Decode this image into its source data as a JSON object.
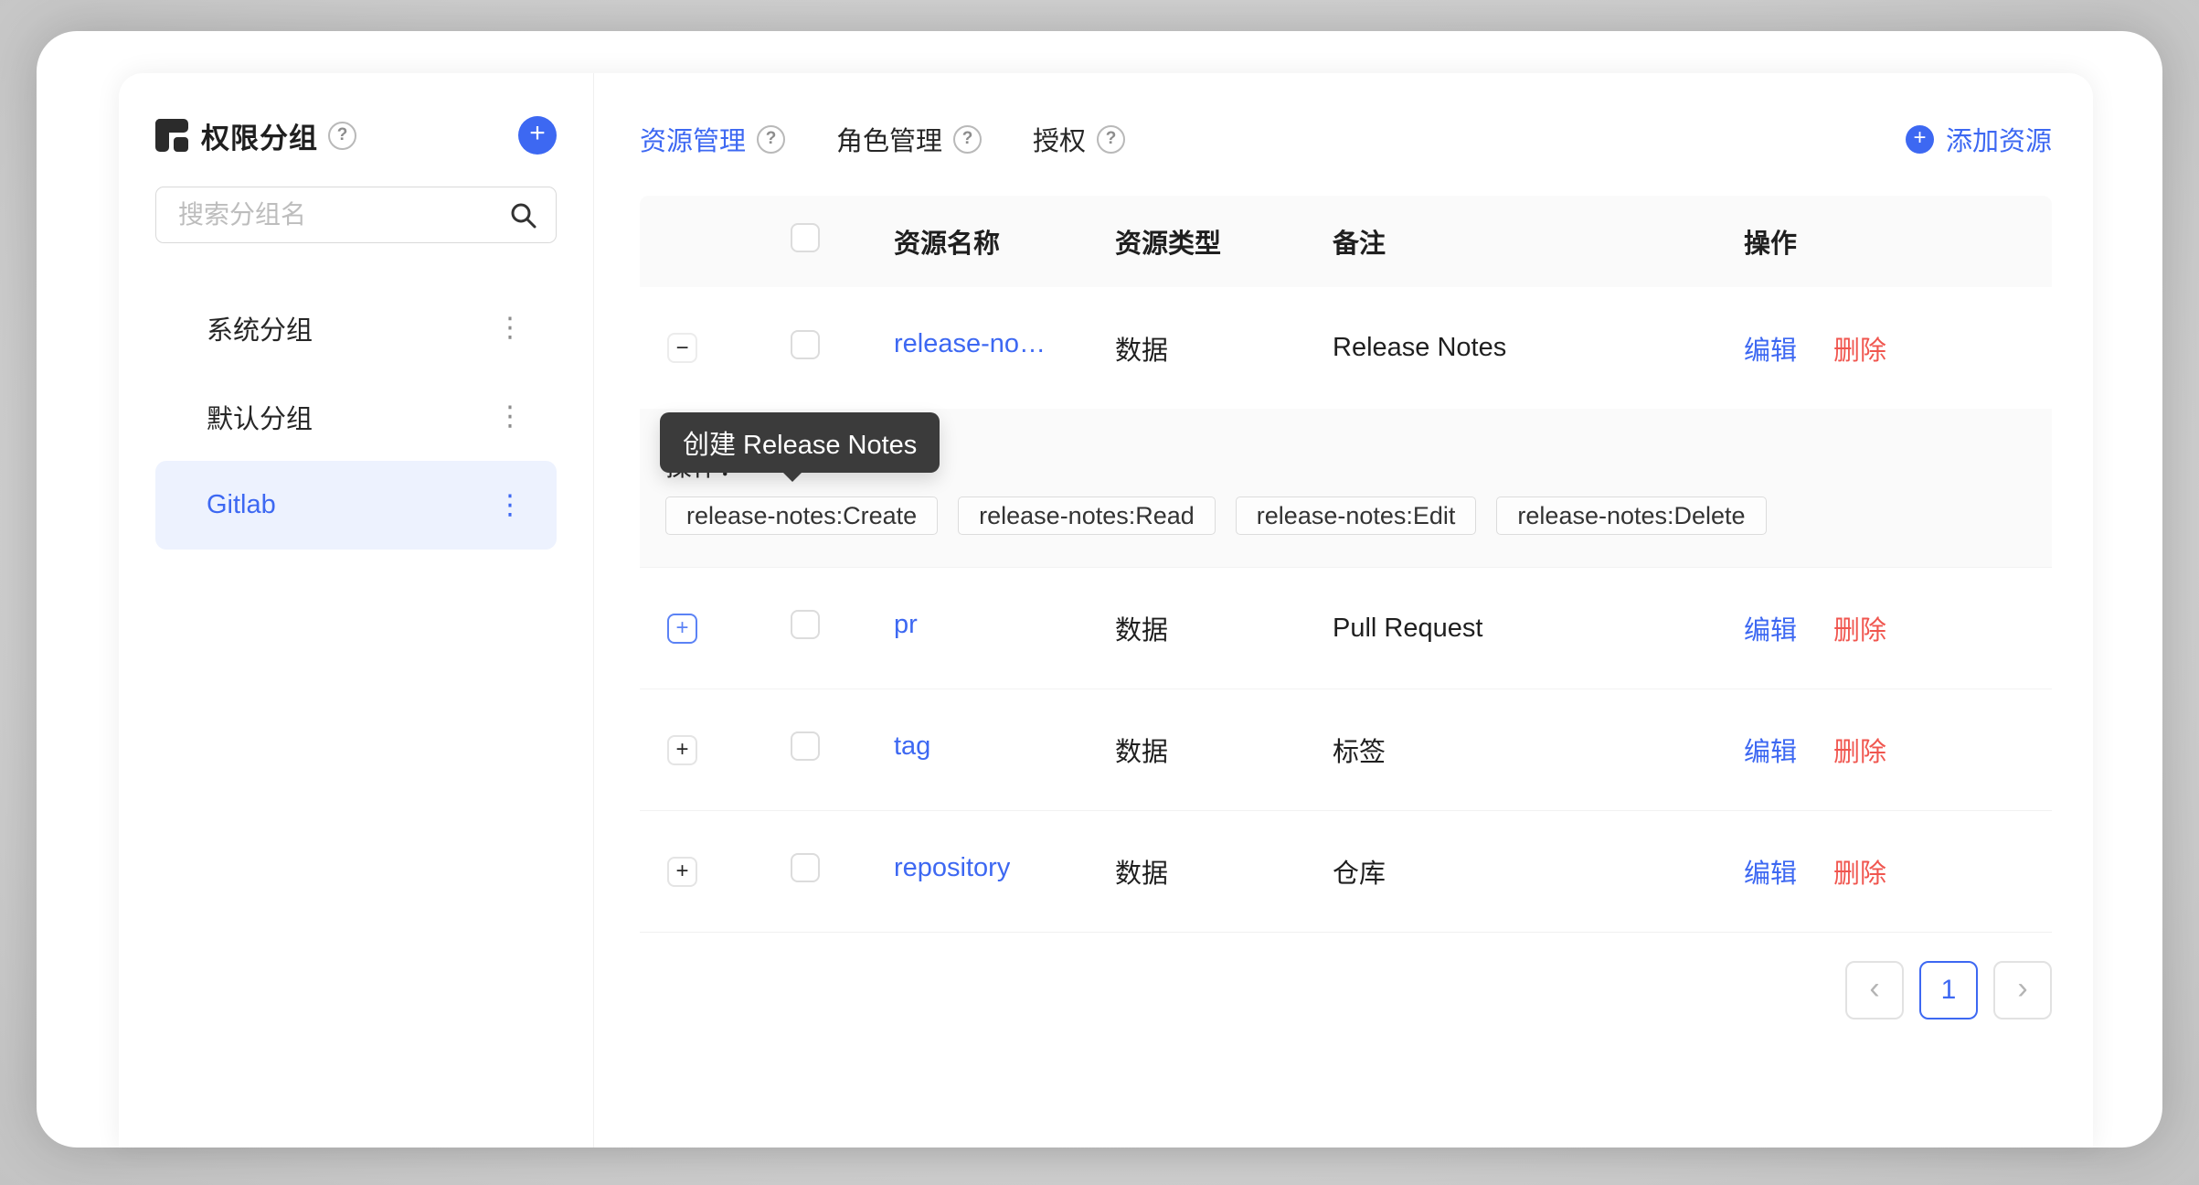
{
  "sidebar": {
    "title": "权限分组",
    "search_placeholder": "搜索分组名",
    "groups": [
      {
        "name": "系统分组",
        "selected": false
      },
      {
        "name": "默认分组",
        "selected": false
      },
      {
        "name": "Gitlab",
        "selected": true
      }
    ]
  },
  "tabs": [
    {
      "label": "资源管理",
      "active": true
    },
    {
      "label": "角色管理",
      "active": false
    },
    {
      "label": "授权",
      "active": false
    }
  ],
  "add_resource_label": "添加资源",
  "table": {
    "headers": {
      "name": "资源名称",
      "type": "资源类型",
      "remark": "备注",
      "actions": "操作"
    },
    "rows": [
      {
        "name": "release-no…",
        "type": "数据",
        "remark": "Release Notes",
        "expanded": true
      },
      {
        "name": "pr",
        "type": "数据",
        "remark": "Pull Request",
        "expanded": false
      },
      {
        "name": "tag",
        "type": "数据",
        "remark": "标签",
        "expanded": false
      },
      {
        "name": "repository",
        "type": "数据",
        "remark": "仓库",
        "expanded": false
      }
    ],
    "edit_label": "编辑",
    "delete_label": "删除",
    "expanded": {
      "label": "操作：",
      "permissions": [
        "release-notes:Create",
        "release-notes:Read",
        "release-notes:Edit",
        "release-notes:Delete"
      ]
    }
  },
  "tooltip": {
    "text": "创建 Release Notes"
  },
  "pagination": {
    "current": "1"
  },
  "icons": {
    "plus": "+",
    "minus": "−",
    "help": "?",
    "kebab": "⋮",
    "chevron_left": "‹",
    "chevron_right": "›"
  },
  "colors": {
    "accent": "#3D68F2",
    "danger": "#F0564F",
    "selected_bg": "#EDF2FE",
    "tooltip_bg": "#3B3B3B",
    "table_header_bg": "#FAFAFA"
  }
}
